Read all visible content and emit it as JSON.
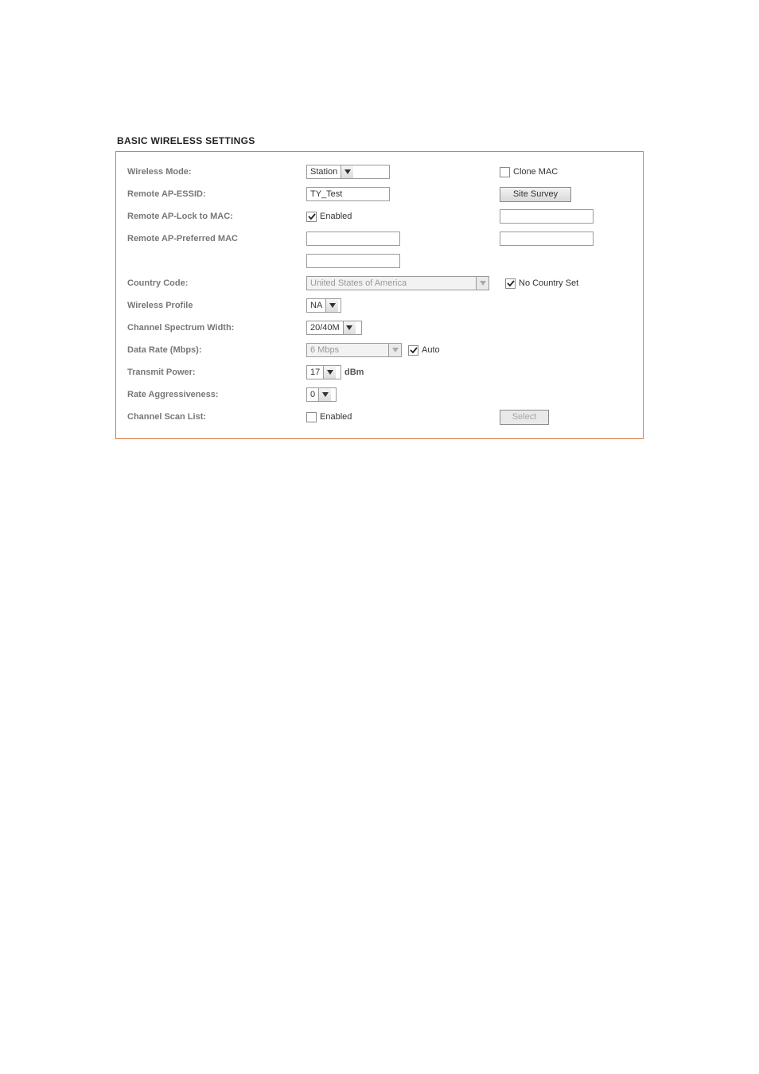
{
  "section_title": "BASIC WIRELESS SETTINGS",
  "rows": {
    "wireless_mode": {
      "label": "Wireless Mode:",
      "value": "Station",
      "clone_mac_label": "Clone MAC",
      "clone_mac_checked": false
    },
    "remote_essid": {
      "label": "Remote AP-ESSID:",
      "value": "TY_Test",
      "site_survey_label": "Site Survey"
    },
    "lock_mac": {
      "label": "Remote AP-Lock to MAC:",
      "enabled_label": "Enabled",
      "enabled_checked": true,
      "mac_value": ""
    },
    "preferred_mac": {
      "label": "Remote AP-Preferred MAC",
      "value1": "",
      "value2": "",
      "value3": ""
    },
    "country": {
      "label": "Country Code:",
      "value": "United States of America",
      "no_country_label": "No Country Set",
      "no_country_checked": true
    },
    "profile": {
      "label": "Wireless Profile",
      "value": "NA"
    },
    "spectrum": {
      "label": "Channel Spectrum Width:",
      "value": "20/40M"
    },
    "data_rate": {
      "label": "Data Rate (Mbps):",
      "value": "6 Mbps",
      "auto_label": "Auto",
      "auto_checked": true
    },
    "tx_power": {
      "label": "Transmit Power:",
      "value": "17",
      "unit": "dBm"
    },
    "aggr": {
      "label": "Rate Aggressiveness:",
      "value": "0"
    },
    "scan_list": {
      "label": "Channel Scan List:",
      "enabled_label": "Enabled",
      "enabled_checked": false,
      "select_label": "Select"
    }
  }
}
